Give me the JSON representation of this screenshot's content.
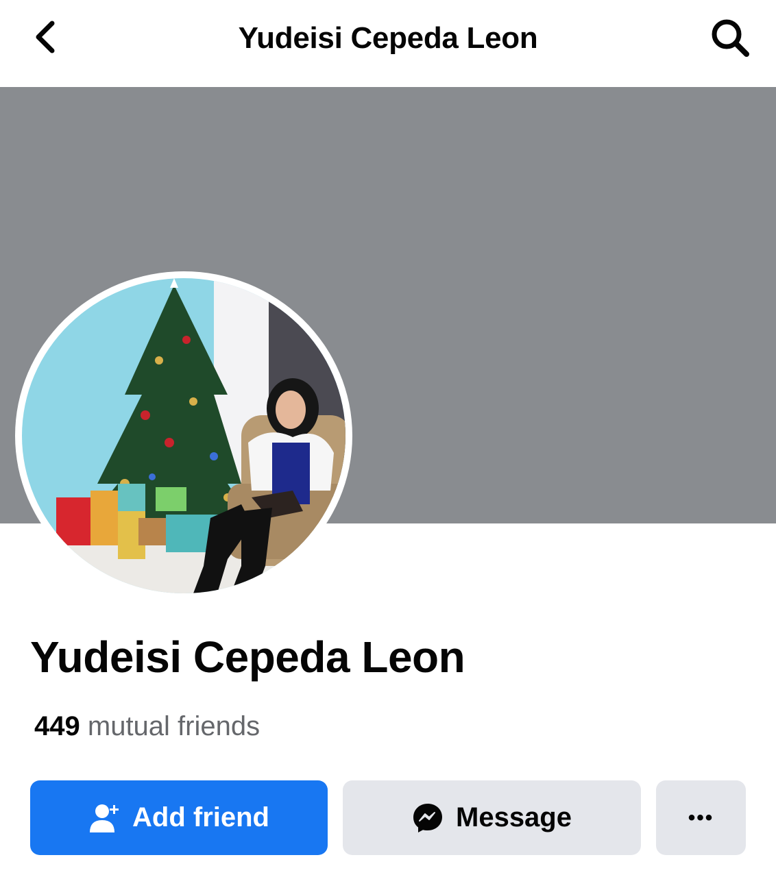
{
  "header": {
    "title": "Yudeisi Cepeda Leon",
    "back_icon": "chevron-left-icon",
    "search_icon": "search-icon"
  },
  "cover": {
    "color": "#898c90"
  },
  "profile": {
    "name": "Yudeisi Cepeda Leon",
    "mutual_count": "449",
    "mutual_label": "mutual friends"
  },
  "actions": {
    "add_friend_label": "Add friend",
    "add_friend_icon": "person-add-icon",
    "message_label": "Message",
    "message_icon": "messenger-icon",
    "more_label": "•••"
  },
  "colors": {
    "primary": "#1877f2",
    "secondary_button": "#e4e6eb",
    "secondary_text": "#65676b"
  }
}
